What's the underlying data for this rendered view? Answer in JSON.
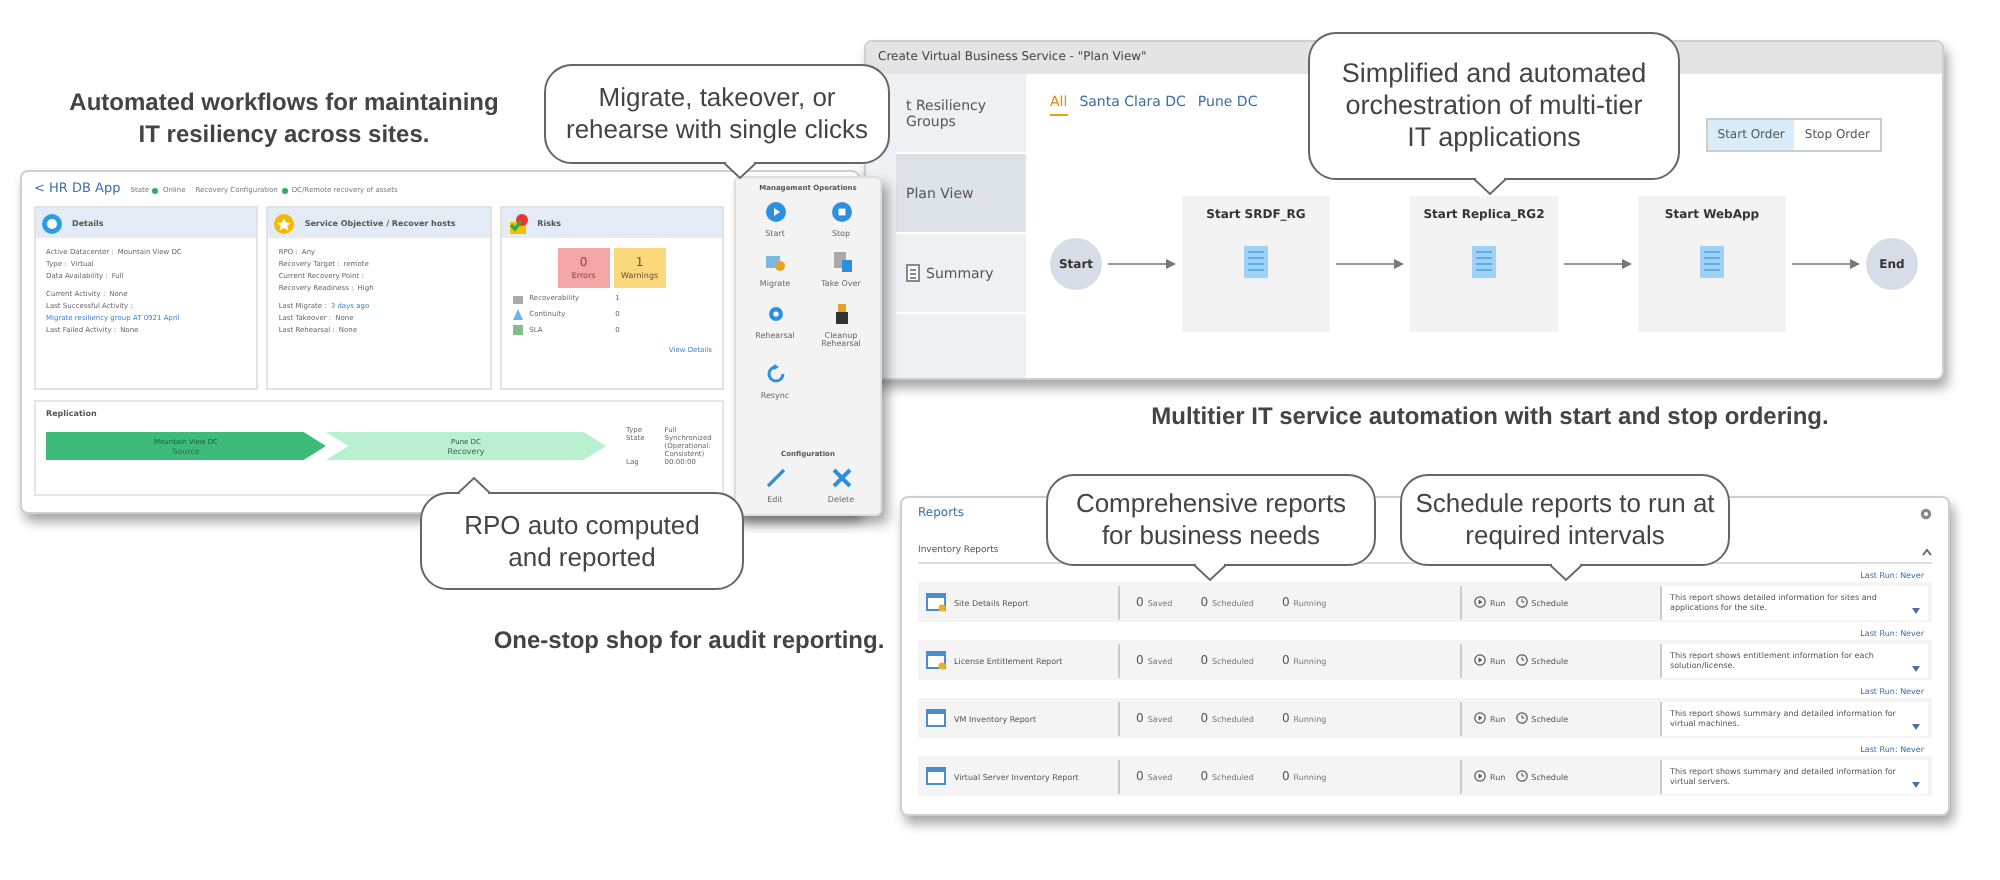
{
  "captions": [
    {
      "text": "Automated workflows for maintaining IT resiliency across sites."
    },
    {
      "text": "Multitier IT service automation with start and stop ordering."
    },
    {
      "text": "One-stop shop for audit reporting."
    }
  ],
  "app_window": {
    "back": "<",
    "title": "HR DB App",
    "breadcrumb": [
      {
        "label": "State",
        "value": "Online",
        "color": "#2eaa5c"
      },
      {
        "label": "Recovery Configuration",
        "value": "DC/Remote recovery of assets",
        "color": "#2eaa5c"
      }
    ],
    "cards": [
      {
        "kind": "details",
        "title": "Details",
        "groups": [
          [
            {
              "label": "Active Datacenter :",
              "value": "Mountain View DC"
            },
            {
              "label": "Type :",
              "value": "Virtual"
            },
            {
              "label": "Data Availability :",
              "value": "Full"
            }
          ],
          [
            {
              "label": "Current Activity :",
              "value": "None"
            },
            {
              "label": "Last Successful Activity :",
              "link": "Migrate resiliency group AT 0921 April"
            },
            {
              "label": "Last Failed Activity :",
              "value": "None"
            }
          ]
        ]
      },
      {
        "kind": "objective",
        "title": "Service Objective / Recover hosts",
        "groups": [
          [
            {
              "label": "RPO :",
              "value": "Any"
            },
            {
              "label": "Recovery Target :",
              "value": "remote"
            },
            {
              "label": "Current Recovery Point :"
            },
            {
              "label": "Recovery Readiness :",
              "value": "High"
            }
          ],
          [
            {
              "label": "Last Migrate :",
              "link": "3 days ago"
            },
            {
              "label": "Last Takeover :",
              "value": "None"
            },
            {
              "label": "Last Rehearsal :",
              "value": "None"
            }
          ]
        ]
      },
      {
        "kind": "risks",
        "title": "Risks",
        "tiles": [
          {
            "count": "0",
            "label": "Errors",
            "color": "#f4a6a6"
          },
          {
            "count": "1",
            "label": "Warnings",
            "color": "#fbd97a"
          }
        ],
        "metrics": [
          {
            "label": "Recoverability",
            "value": "1"
          },
          {
            "label": "Continuity",
            "value": "0"
          },
          {
            "label": "SLA",
            "value": "0"
          }
        ],
        "link": "View Details"
      }
    ],
    "replication": {
      "title": "Replication",
      "sites": [
        {
          "name": "Mountain View DC",
          "role": "Source",
          "color": "#3dbb78"
        },
        {
          "name": "Pune DC",
          "role": "Recovery",
          "color": "#b9f0cf"
        }
      ],
      "props": [
        {
          "label": "Type",
          "value": "Full"
        },
        {
          "label": "State",
          "value": "Synchronized (Operational: Consistent)"
        },
        {
          "label": "Lag",
          "value": "00:00:00"
        }
      ]
    }
  },
  "management_panel": {
    "title": "Management Operations",
    "ops": [
      {
        "label": "Start"
      },
      {
        "label": "Stop"
      },
      {
        "label": "Migrate"
      },
      {
        "label": "Take Over"
      },
      {
        "label": "Rehearsal"
      },
      {
        "label": "Cleanup Rehearsal"
      },
      {
        "label": "Resync"
      }
    ],
    "config_title": "Configuration",
    "config_ops": [
      {
        "label": "Edit"
      },
      {
        "label": "Delete"
      }
    ]
  },
  "plan_window": {
    "title": "Create Virtual Business Service - \"Plan View\"",
    "steps": [
      {
        "label": "t Resiliency Groups",
        "selected": false
      },
      {
        "label": "Plan View",
        "selected": true
      },
      {
        "label": "Summary",
        "selected": false
      }
    ],
    "filters": [
      {
        "label": "All",
        "selected": true
      },
      {
        "label": "Santa Clara DC",
        "selected": false
      },
      {
        "label": "Pune DC",
        "selected": false
      }
    ],
    "order_buttons": [
      {
        "label": "Start Order",
        "selected": true
      },
      {
        "label": "Stop Order",
        "selected": false
      }
    ],
    "flow": [
      {
        "kind": "terminal",
        "label": "Start"
      },
      {
        "kind": "step",
        "label": "Start SRDF_RG"
      },
      {
        "kind": "step",
        "label": "Start Replica_RG2"
      },
      {
        "kind": "step",
        "label": "Start WebApp"
      },
      {
        "kind": "terminal",
        "label": "End"
      }
    ]
  },
  "reports_window": {
    "title": "Reports",
    "section": "Inventory Reports",
    "rows": [
      {
        "name": "Site Details Report",
        "saved": "0",
        "saved_label": "Saved",
        "scheduled": "0",
        "scheduled_label": "Scheduled",
        "running": "0",
        "running_label": "Running",
        "run": "Run",
        "schedule": "Schedule",
        "last_run": "Last Run: Never",
        "description": "This report shows detailed information for sites and applications for the site."
      },
      {
        "name": "License Entitlement Report",
        "saved": "0",
        "saved_label": "Saved",
        "scheduled": "0",
        "scheduled_label": "Scheduled",
        "running": "0",
        "running_label": "Running",
        "run": "Run",
        "schedule": "Schedule",
        "last_run": "Last Run: Never",
        "description": "This report shows entitlement information for each solution/license."
      },
      {
        "name": "VM Inventory Report",
        "saved": "0",
        "saved_label": "Saved",
        "scheduled": "0",
        "scheduled_label": "Scheduled",
        "running": "0",
        "running_label": "Running",
        "run": "Run",
        "schedule": "Schedule",
        "last_run": "Last Run: Never",
        "description": "This report shows summary and detailed information for virtual machines."
      },
      {
        "name": "Virtual Server Inventory Report",
        "saved": "0",
        "saved_label": "Saved",
        "scheduled": "0",
        "scheduled_label": "Scheduled",
        "running": "0",
        "running_label": "Running",
        "run": "Run",
        "schedule": "Schedule",
        "last_run": "Last Run: Never",
        "description": "This report shows summary and detailed information for virtual servers."
      }
    ]
  },
  "callouts": [
    {
      "text": "Migrate, takeover, or rehearse with single clicks"
    },
    {
      "text": "RPO auto computed and reported"
    },
    {
      "text": "Simplified and automated orchestration of multi-tier IT applications"
    },
    {
      "text": "Comprehensive reports for business needs"
    },
    {
      "text": "Schedule reports to run at required intervals"
    }
  ]
}
